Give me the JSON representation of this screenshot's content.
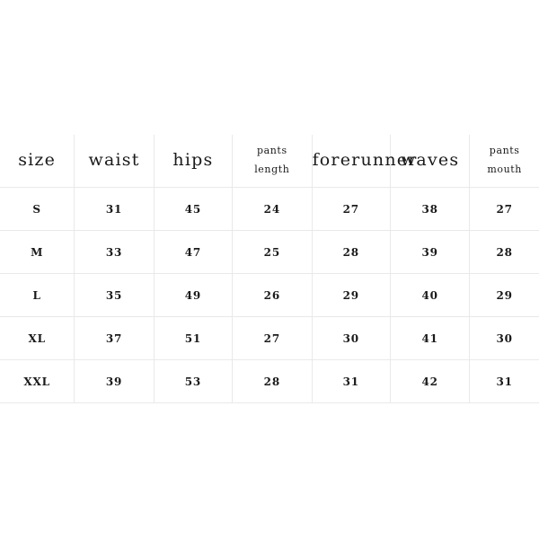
{
  "table": {
    "name": "size-chart",
    "header": [
      {
        "label": "size",
        "lines": [
          "size"
        ],
        "style": "large"
      },
      {
        "label": "waist",
        "lines": [
          "waist"
        ],
        "style": "large"
      },
      {
        "label": "hips",
        "lines": [
          "hips"
        ],
        "style": "large"
      },
      {
        "label": "pants length",
        "lines": [
          "pants",
          "length"
        ],
        "style": "small"
      },
      {
        "label": "forerunner",
        "lines": [
          "forerunner"
        ],
        "style": "large"
      },
      {
        "label": "waves",
        "lines": [
          "waves"
        ],
        "style": "large"
      },
      {
        "label": "pants mouth",
        "lines": [
          "pants",
          "mouth"
        ],
        "style": "small"
      }
    ],
    "rows": [
      {
        "size": "S",
        "cells": [
          "S",
          "31",
          "45",
          "24",
          "27",
          "38",
          "27"
        ]
      },
      {
        "size": "M",
        "cells": [
          "M",
          "33",
          "47",
          "25",
          "28",
          "39",
          "28"
        ]
      },
      {
        "size": "L",
        "cells": [
          "L",
          "35",
          "49",
          "26",
          "29",
          "40",
          "29"
        ]
      },
      {
        "size": "XL",
        "cells": [
          "XL",
          "37",
          "51",
          "27",
          "30",
          "41",
          "30"
        ]
      },
      {
        "size": "XXL",
        "cells": [
          "XXL",
          "39",
          "53",
          "28",
          "31",
          "42",
          "31"
        ]
      }
    ]
  },
  "colors": {
    "background": "#ffffff",
    "grid_line": "#e9e9e9",
    "text": "#1a1a1a"
  }
}
